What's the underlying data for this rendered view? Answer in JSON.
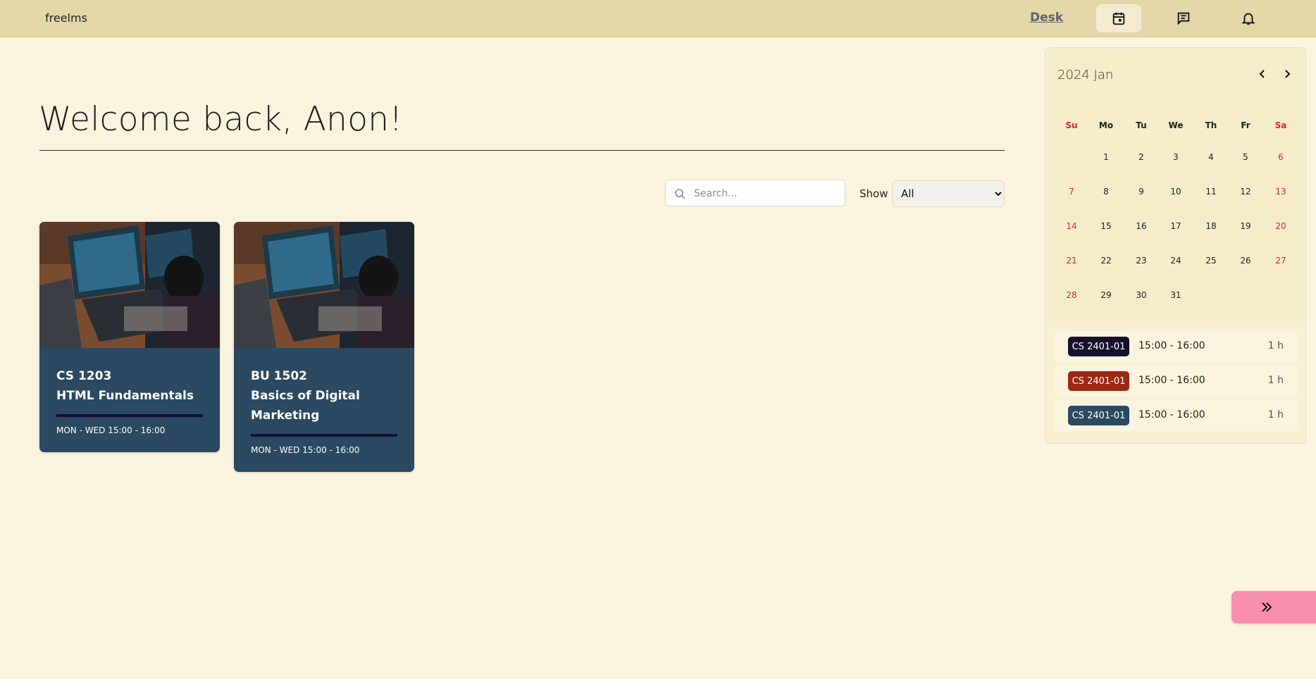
{
  "app": {
    "brand": "freelms"
  },
  "nav": {
    "desk_label": "Desk",
    "icons": [
      "calendar-icon",
      "message-icon",
      "bell-icon"
    ]
  },
  "main": {
    "welcome": "Welcome back, Anon!",
    "search_placeholder": "Search...",
    "show_label": "Show",
    "show_selected": "All"
  },
  "courses": [
    {
      "code": "CS 1203",
      "title": "HTML Fundamentals",
      "schedule": "MON - WED 15:00 - 16:00"
    },
    {
      "code": "BU 1502",
      "title": "Basics of Digital Marketing",
      "schedule": "MON - WED 15:00 - 16:00"
    }
  ],
  "calendar": {
    "title": "2024 Jan",
    "weekdays": [
      "Su",
      "Mo",
      "Tu",
      "We",
      "Th",
      "Fr",
      "Sa"
    ],
    "weeks": [
      [
        "",
        "1",
        "2",
        "3",
        "4",
        "5",
        "6"
      ],
      [
        "7",
        "8",
        "9",
        "10",
        "11",
        "12",
        "13"
      ],
      [
        "14",
        "15",
        "16",
        "17",
        "18",
        "19",
        "20"
      ],
      [
        "21",
        "22",
        "23",
        "24",
        "25",
        "26",
        "27"
      ],
      [
        "28",
        "29",
        "30",
        "31",
        "",
        "",
        ""
      ]
    ],
    "events": [
      {
        "tag": "CS 2401-01",
        "time": "15:00 - 16:00",
        "duration": "1 h",
        "color": "#15102e"
      },
      {
        "tag": "CS 2401-01",
        "time": "15:00 - 16:00",
        "duration": "1 h",
        "color": "#9b2915"
      },
      {
        "tag": "CS 2401-01",
        "time": "15:00 - 16:00",
        "duration": "1 h",
        "color": "#2b4960"
      }
    ]
  },
  "colors": {
    "background": "#faf3dd",
    "topbar": "#e4d7a7",
    "card": "#2b4960",
    "weekend": "#d7263d",
    "collapse_button": "#f98fae"
  }
}
